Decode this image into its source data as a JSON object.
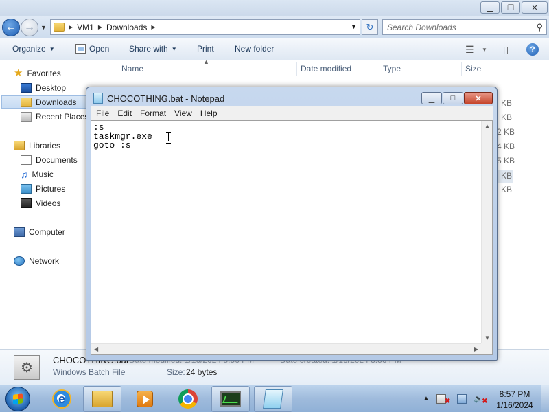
{
  "explorer": {
    "caption": {
      "minimize": "▁",
      "maximize": "❐",
      "close": "✕"
    },
    "address": {
      "crumbs": [
        "VM1",
        "Downloads"
      ]
    },
    "search": {
      "placeholder": "Search Downloads"
    },
    "toolbar": {
      "organize": "Organize",
      "open": "Open",
      "share_with": "Share with",
      "print": "Print",
      "new_folder": "New folder"
    },
    "nav": {
      "favorites": "Favorites",
      "desktop": "Desktop",
      "downloads": "Downloads",
      "recent_places": "Recent Places",
      "libraries": "Libraries",
      "documents": "Documents",
      "music": "Music",
      "pictures": "Pictures",
      "videos": "Videos",
      "computer": "Computer",
      "network": "Network"
    },
    "columns": {
      "name": "Name",
      "date_modified": "Date modified",
      "type": "Type",
      "size": "Size"
    },
    "visible_size_fragments": [
      "KB",
      "KB",
      "2 KB",
      "4 KB",
      "5 KB",
      "KB",
      "KB"
    ],
    "details": {
      "name": "CHOCOTHING.bat",
      "date_modified_label": "Date modified: 1/16/2024 8:56 PM",
      "date_created_label": "Date created: 1/16/2024 8:56 PM",
      "type": "Windows Batch File",
      "size_label": "Size:",
      "size_value": "24 bytes"
    }
  },
  "notepad": {
    "title": "CHOCOTHING.bat - Notepad",
    "menu": [
      "File",
      "Edit",
      "Format",
      "View",
      "Help"
    ],
    "content": ":s\ntaskmgr.exe\ngoto :s"
  },
  "taskbar": {
    "clock_time": "8:57 PM",
    "clock_date": "1/16/2024",
    "tray_arrow": "▲"
  },
  "colors": {
    "accent": "#1f5fb4",
    "selection": "#c6dbf3",
    "close_red": "#c5442a"
  },
  "icons": {
    "back": "back-arrow-icon",
    "forward": "forward-arrow-icon",
    "search": "search-icon",
    "help": "help-icon",
    "start": "windows-start-icon"
  }
}
